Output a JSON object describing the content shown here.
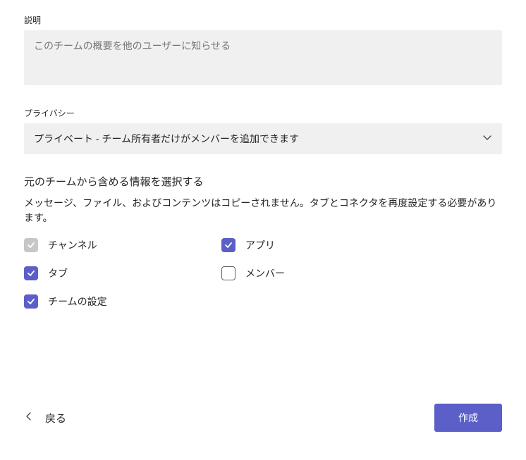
{
  "description": {
    "label": "説明",
    "placeholder": "このチームの概要を他のユーザーに知らせる",
    "value": ""
  },
  "privacy": {
    "label": "プライバシー",
    "selected": "プライベート - チーム所有者だけがメンバーを追加できます"
  },
  "include": {
    "heading": "元のチームから含める情報を選択する",
    "help": "メッセージ、ファイル、およびコンテンツはコピーされません。タブとコネクタを再度設定する必要があります。",
    "options": {
      "channels": {
        "label": "チャンネル",
        "checked": true,
        "disabled": true
      },
      "apps": {
        "label": "アプリ",
        "checked": true,
        "disabled": false
      },
      "tabs": {
        "label": "タブ",
        "checked": true,
        "disabled": false
      },
      "members": {
        "label": "メンバー",
        "checked": false,
        "disabled": false
      },
      "settings": {
        "label": "チームの設定",
        "checked": true,
        "disabled": false
      }
    }
  },
  "footer": {
    "back": "戻る",
    "create": "作成"
  }
}
